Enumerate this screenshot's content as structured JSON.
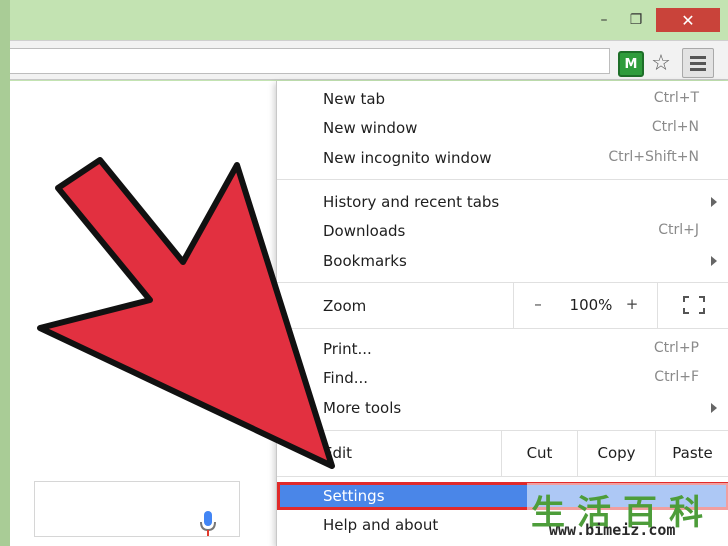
{
  "window": {
    "controls": {
      "minimize": "–",
      "maximize": "❐",
      "close": "✕"
    }
  },
  "toolbar": {
    "extension_label": "M",
    "icons": [
      "extension-icon",
      "star-icon",
      "hamburger-menu-icon"
    ]
  },
  "menu": {
    "group1": [
      {
        "label": "New tab",
        "shortcut": "Ctrl+T"
      },
      {
        "label": "New window",
        "shortcut": "Ctrl+N"
      },
      {
        "label": "New incognito window",
        "shortcut": "Ctrl+Shift+N"
      }
    ],
    "group2": [
      {
        "label": "History and recent tabs",
        "has_submenu": true
      },
      {
        "label": "Downloads",
        "shortcut": "Ctrl+J"
      },
      {
        "label": "Bookmarks",
        "has_submenu": true
      }
    ],
    "zoom": {
      "label": "Zoom",
      "minus": "–",
      "value": "100%",
      "plus": "+"
    },
    "group3": [
      {
        "label": "Print...",
        "shortcut": "Ctrl+P"
      },
      {
        "label": "Find...",
        "shortcut": "Ctrl+F"
      },
      {
        "label": "More tools",
        "has_submenu": true
      }
    ],
    "edit": {
      "label": "Edit",
      "cut": "Cut",
      "copy": "Copy",
      "paste": "Paste"
    },
    "settings": {
      "label": "Settings"
    },
    "help": {
      "label": "Help and about"
    }
  },
  "colors": {
    "highlight": "#4a86e8",
    "highlight_border": "#e02a2a",
    "arrow_fill": "#e23040",
    "window_frame": "#c3e3b2"
  },
  "watermark": {
    "chars": "生活百科",
    "url": "www.bimeiz.com"
  }
}
